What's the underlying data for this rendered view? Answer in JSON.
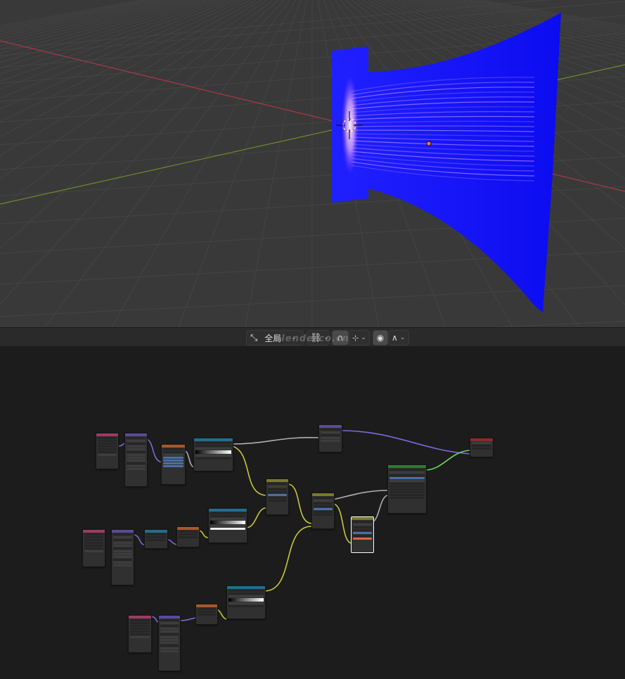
{
  "viewport": {
    "grid_color": "#444444",
    "bg_color": "#393939",
    "x_axis_color": "#a83a45",
    "y_axis_color": "#6d8a2a",
    "plane_color": "#1010ff",
    "streak_color": "#d8a0ff"
  },
  "toolbar": {
    "transform_icon": "transform-pivot-icon",
    "orientation_label": "全局",
    "snap_icon": "snap-link-icon",
    "proportional_icon": "magnet-icon",
    "snap_target_icon": "snap-increment-icon",
    "falloff_icon": "falloff-curve-icon",
    "overlay_icon": "circle-dot-icon"
  },
  "watermark": "blenderco.cn",
  "node_editor": {
    "colors": {
      "input": "#9e3a62",
      "vector": "#5a4a9c",
      "converter": "#a8572a",
      "ramp": "#1f6f8f",
      "mix": "#7a7a2a",
      "shader": "#2f7a33",
      "output": "#8a2a2a",
      "link_yellow": "#c8c83a",
      "link_purple": "#7a6ad8",
      "link_green": "#6ad85a",
      "link_grey": "#b0b0b0"
    }
  }
}
